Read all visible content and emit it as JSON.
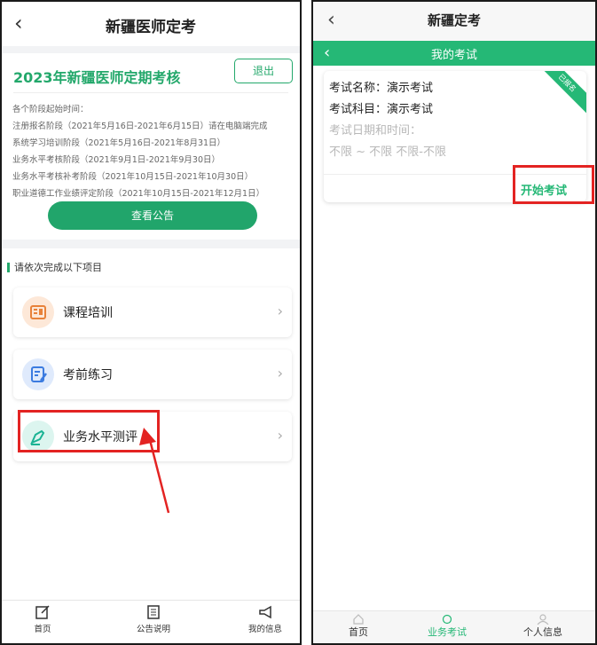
{
  "left": {
    "header": {
      "back": "‹",
      "title": "新疆医师定考"
    },
    "card": {
      "heading": "2023年新疆医师定期考核",
      "logout_label": "退出",
      "info_lines": [
        "各个阶段起始时间：",
        "注册报名阶段（2021年5月16日-2021年6月15日）请在电脑端完成",
        "系统学习培训阶段（2021年5月16日-2021年8月31日）",
        "业务水平考核阶段（2021年9月1日-2021年9月30日）",
        "业务水平考核补考阶段（2021年10月15日-2021年10月30日）",
        "职业道德工作业绩评定阶段（2021年10月15日-2021年12月1日）"
      ],
      "notice_button": "查看公告"
    },
    "section": {
      "title": "请依次完成以下项目",
      "items": [
        {
          "label": "课程培训",
          "icon": "course-training-icon"
        },
        {
          "label": "考前练习",
          "icon": "practice-icon"
        },
        {
          "label": "业务水平测评",
          "icon": "assessment-icon"
        }
      ]
    },
    "tabbar": [
      {
        "label": "首页",
        "icon": "edit-icon"
      },
      {
        "label": "公告说明",
        "icon": "notice-icon"
      },
      {
        "label": "我的信息",
        "icon": "megaphone-icon"
      }
    ],
    "colors": {
      "accent": "#23a86b",
      "highlight": "#e32322"
    }
  },
  "right": {
    "header": {
      "back": "‹",
      "title": "新疆定考"
    },
    "subbar": {
      "back": "‹",
      "title": "我的考试"
    },
    "exam": {
      "name_line": "考试名称：演示考试",
      "subject_line": "考试科目：演示考试",
      "datetime_label": "考试日期和时间：",
      "datetime_value": "不限 ~ 不限   不限-不限",
      "status_ribbon": "已报名",
      "start_button": "开始考试"
    },
    "tabbar": [
      {
        "label": "首页",
        "icon": "home-icon"
      },
      {
        "label": "业务考试",
        "icon": "exam-icon"
      },
      {
        "label": "个人信息",
        "icon": "person-icon"
      }
    ],
    "colors": {
      "accent": "#25b876"
    }
  }
}
